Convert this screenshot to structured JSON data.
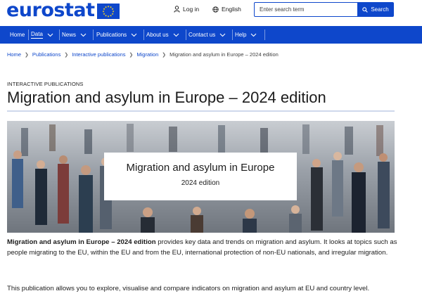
{
  "header": {
    "logo_text": "eurostat",
    "login_label": "Log in",
    "language_label": "English",
    "search_placeholder": "Enter search term",
    "search_button": "Search"
  },
  "nav": {
    "items": [
      {
        "label": "Home",
        "has_dropdown": false
      },
      {
        "label": "Data",
        "has_dropdown": true,
        "active": true
      },
      {
        "label": "News",
        "has_dropdown": true
      },
      {
        "label": "Publications",
        "has_dropdown": true
      },
      {
        "label": "About us",
        "has_dropdown": true
      },
      {
        "label": "Contact us",
        "has_dropdown": true
      },
      {
        "label": "Help",
        "has_dropdown": true
      }
    ]
  },
  "breadcrumb": {
    "items": [
      "Home",
      "Publications",
      "Interactive publications",
      "Migration"
    ],
    "current": "Migration and asylum in Europe – 2024 edition"
  },
  "page": {
    "kicker": "INTERACTIVE PUBLICATIONS",
    "title": "Migration and asylum in Europe – 2024 edition"
  },
  "hero": {
    "title": "Migration and asylum in Europe",
    "subtitle": "2024 edition"
  },
  "intro": {
    "bold_lead": "Migration and asylum in Europe – 2024 edition",
    "text": " provides key data and trends on migration and asylum. It looks at topics such as people migrating to the EU, within the EU and from the EU, international protection of non-EU nationals, and irregular migration.",
    "second_paragraph": "This publication allows you to explore, visualise and compare indicators on migration and asylum at EU and country level."
  },
  "colors": {
    "brand_blue": "#0e47cb",
    "text": "#1c1c1c",
    "eu_star": "#ffd617"
  },
  "icons": [
    "eu-flag-icon",
    "user-icon",
    "globe-icon",
    "search-icon",
    "chevron-down-icon",
    "chevron-right-icon"
  ]
}
